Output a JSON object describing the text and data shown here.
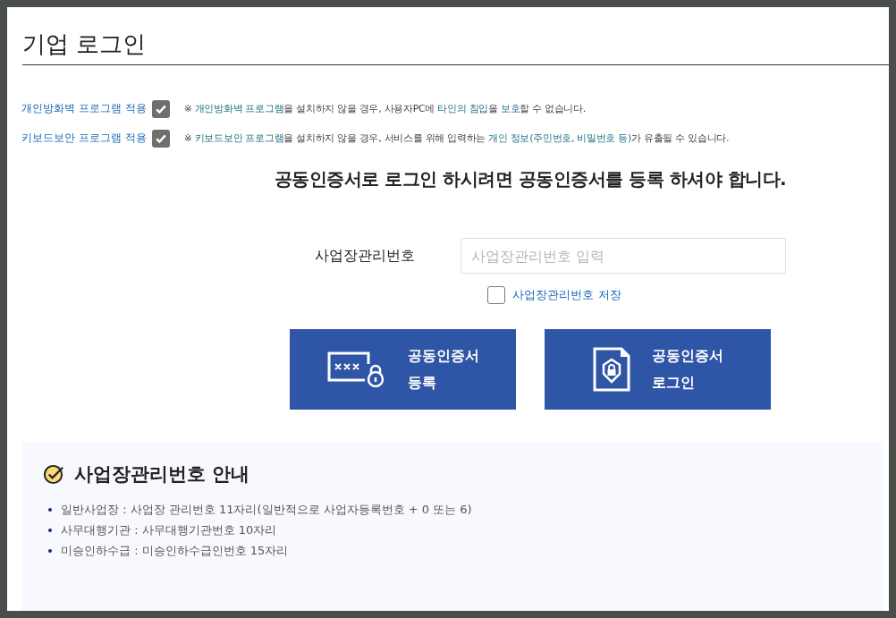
{
  "page_title": "기업 로그인",
  "security_options": [
    {
      "label": "개인방화벽 프로그램 적용",
      "checked": true,
      "notice": "※ **개인방화벽 프로그램**을 설치하지 않을 경우, 사용자PC에 **타인의 침입**을 **보호**할 수 없습니다."
    },
    {
      "label": "키보드보안 프로그램 적용",
      "checked": true,
      "notice": "※ **키보드보안 프로그램**을 설치하지 않을 경우, 서비스를 위해 입력하는 **개인 정보(주민번호, 비밀번호 등)**가 유출될 수 있습니다."
    }
  ],
  "headline": "공동인증서로 로그인 하시려면 공동인증서를 등록 하셔야 합니다.",
  "business_number": {
    "label": "사업장관리번호",
    "placeholder": "사업장관리번호 입력",
    "save_label": "사업장관리번호 저장",
    "save_checked": false
  },
  "buttons": [
    {
      "kind": "register",
      "line1": "공동인증서",
      "line2": "등록"
    },
    {
      "kind": "login",
      "line1": "공동인증서",
      "line2": "로그인"
    }
  ],
  "guide": {
    "title": "사업장관리번호 안내",
    "items": [
      "일반사업장 : 사업장 관리번호 11자리(일반적으로 사업자등록번호 + 0 또는 6)",
      "사무대행기관 : 사무대행기관번호 10자리",
      "미승인하수급 : 미승인하수급인번호 15자리"
    ]
  }
}
